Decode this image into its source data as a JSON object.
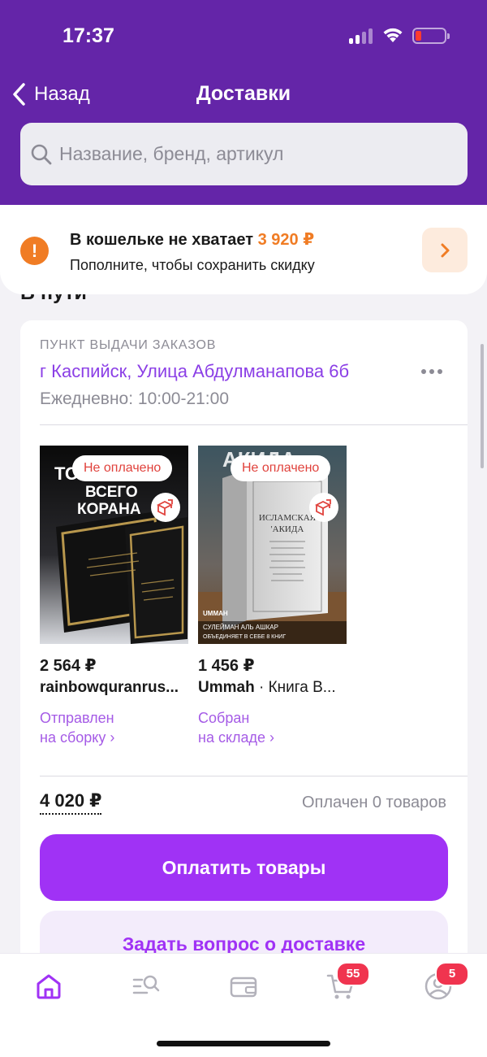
{
  "status_bar": {
    "time": "17:37"
  },
  "header": {
    "back_label": "Назад",
    "title": "Доставки",
    "search_placeholder": "Название, бренд, артикул"
  },
  "wallet_banner": {
    "title": "В кошельке не хватает",
    "amount": "3 920 ₽",
    "subtitle": "Пополните, чтобы сохранить скидку"
  },
  "section_title": "В пути",
  "pickup": {
    "label": "ПУНКТ ВЫДАЧИ ЗАКАЗОВ",
    "address": "г Каспийск, Улица Абдулманапова 6б",
    "hours": "Ежедневно: 10:00-21:00"
  },
  "products": [
    {
      "badge": "Не оплачено",
      "cover_line1": "ВСЕГО",
      "cover_line2": "КОРАНА",
      "price": "2 564 ₽",
      "seller": "rainbowquranrus...",
      "status_line1": "Отправлен",
      "status_line2": "на сборку ›"
    },
    {
      "badge": "Не оплачено",
      "cover_title": "ИСЛАМСКАЯ 'АКИДА",
      "cover_publisher": "UMMAH",
      "cover_caption1": "СУЛЕЙМАН АЛЬ АШКАР",
      "cover_caption2": "ОБЪЕДИНЯЕТ В СЕБЕ 8 КНИГ",
      "price": "1 456 ₽",
      "seller": "Ummah",
      "product_name": " · Книга В...",
      "status_line1": "Собран",
      "status_line2": "на складе ›"
    }
  ],
  "order": {
    "total": "4 020 ₽",
    "paid_count": "Оплачен 0 товаров",
    "pay_button": "Оплатить товары",
    "ask_button": "Задать вопрос о доставке"
  },
  "tabbar": {
    "cart_badge": "55",
    "profile_badge": "5"
  },
  "colors": {
    "header_bg": "#6425a8",
    "accent": "#a032f5",
    "warning": "#f07c24",
    "unpaid": "#e0423c"
  },
  "icons": [
    "chevron-left-icon",
    "search-icon",
    "alert-icon",
    "chevron-right-icon",
    "more-icon",
    "box-icon",
    "home-icon",
    "catalog-search-icon",
    "wallet-icon",
    "cart-icon",
    "profile-icon"
  ]
}
